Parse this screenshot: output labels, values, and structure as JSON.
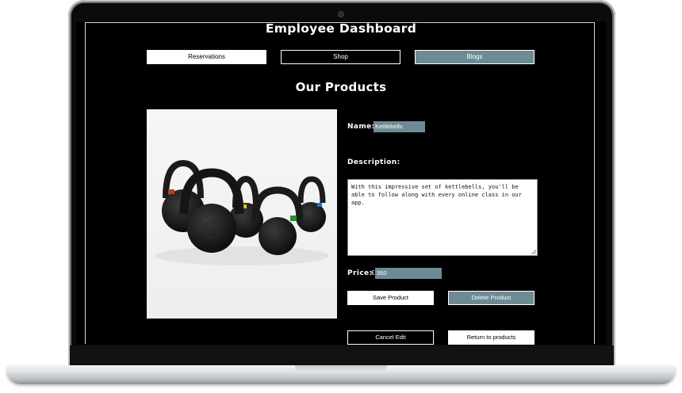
{
  "header": {
    "title": "Employee Dashboard"
  },
  "nav": {
    "reservations_label": "Reservations",
    "shop_label": "Shop",
    "blogs_label": "Blogs"
  },
  "section": {
    "title": "Our Products"
  },
  "product": {
    "image_icon": "kettlebells-photo",
    "name_label": "Name:",
    "name_value": "Kettlebells",
    "description_label": "Description:",
    "description_value": "With this impressive set of kettlebells, you'll be able to follow along with every online class in our app.",
    "price_label": "Price:",
    "currency_symbol": "€",
    "price_value": "350"
  },
  "actions": {
    "save_label": "Save Product",
    "delete_label": "Delete Product",
    "cancel_label": "Cancel Edit",
    "return_label": "Return to products"
  },
  "colors": {
    "background": "#000000",
    "accent": "#6e8b95",
    "text": "#ffffff"
  }
}
